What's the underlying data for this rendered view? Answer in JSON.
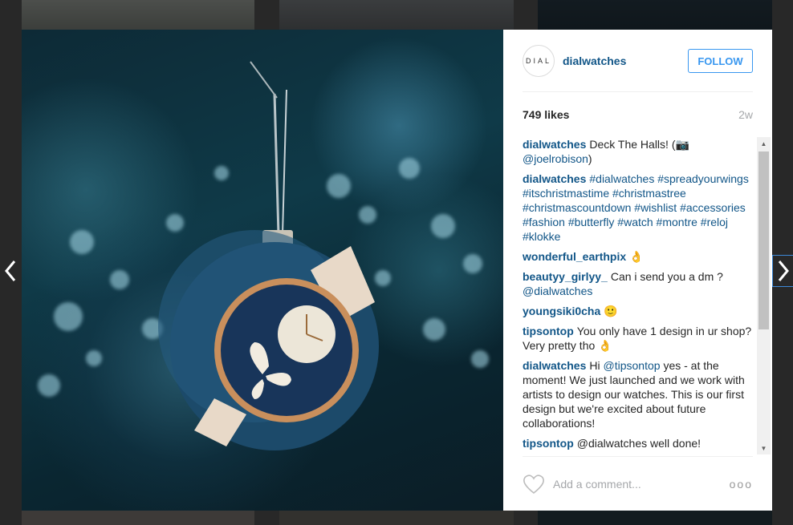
{
  "post": {
    "avatar_text": "DIAL",
    "username": "dialwatches",
    "follow_label": "FOLLOW",
    "likes_count": "749",
    "likes_word": "likes",
    "time_ago": "2w"
  },
  "comments": [
    {
      "user": "dialwatches",
      "text": "Deck The Halls! (📷",
      "mention": "@joelrobison",
      "tail": ")"
    },
    {
      "user": "dialwatches",
      "tags": "#dialwatches #spreadyourwings #itschristmastime #christmastree #christmascountdown #wishlist #accessories #fashion #butterfly #watch #montre #reloj #klokke"
    },
    {
      "user": "wonderful_earthpix",
      "text": "👌"
    },
    {
      "user": "beautyy_girlyy_",
      "text": "Can i send you a dm ?",
      "mention": "@dialwatches"
    },
    {
      "user": "youngsiki0cha",
      "text": "🙂"
    },
    {
      "user": "tipsontop",
      "text": "You only have 1 design in ur shop? Very pretty tho 👌"
    },
    {
      "user": "dialwatches",
      "text_before": "Hi",
      "mention": "@tipsontop",
      "text": "yes - at the moment! We just launched and we work with artists to design our watches. This is our first design but we're excited about future collaborations!"
    },
    {
      "user": "tipsontop",
      "text": "@dialwatches well done!"
    }
  ],
  "footer": {
    "comment_placeholder": "Add a comment...",
    "more_label": "ooo"
  }
}
